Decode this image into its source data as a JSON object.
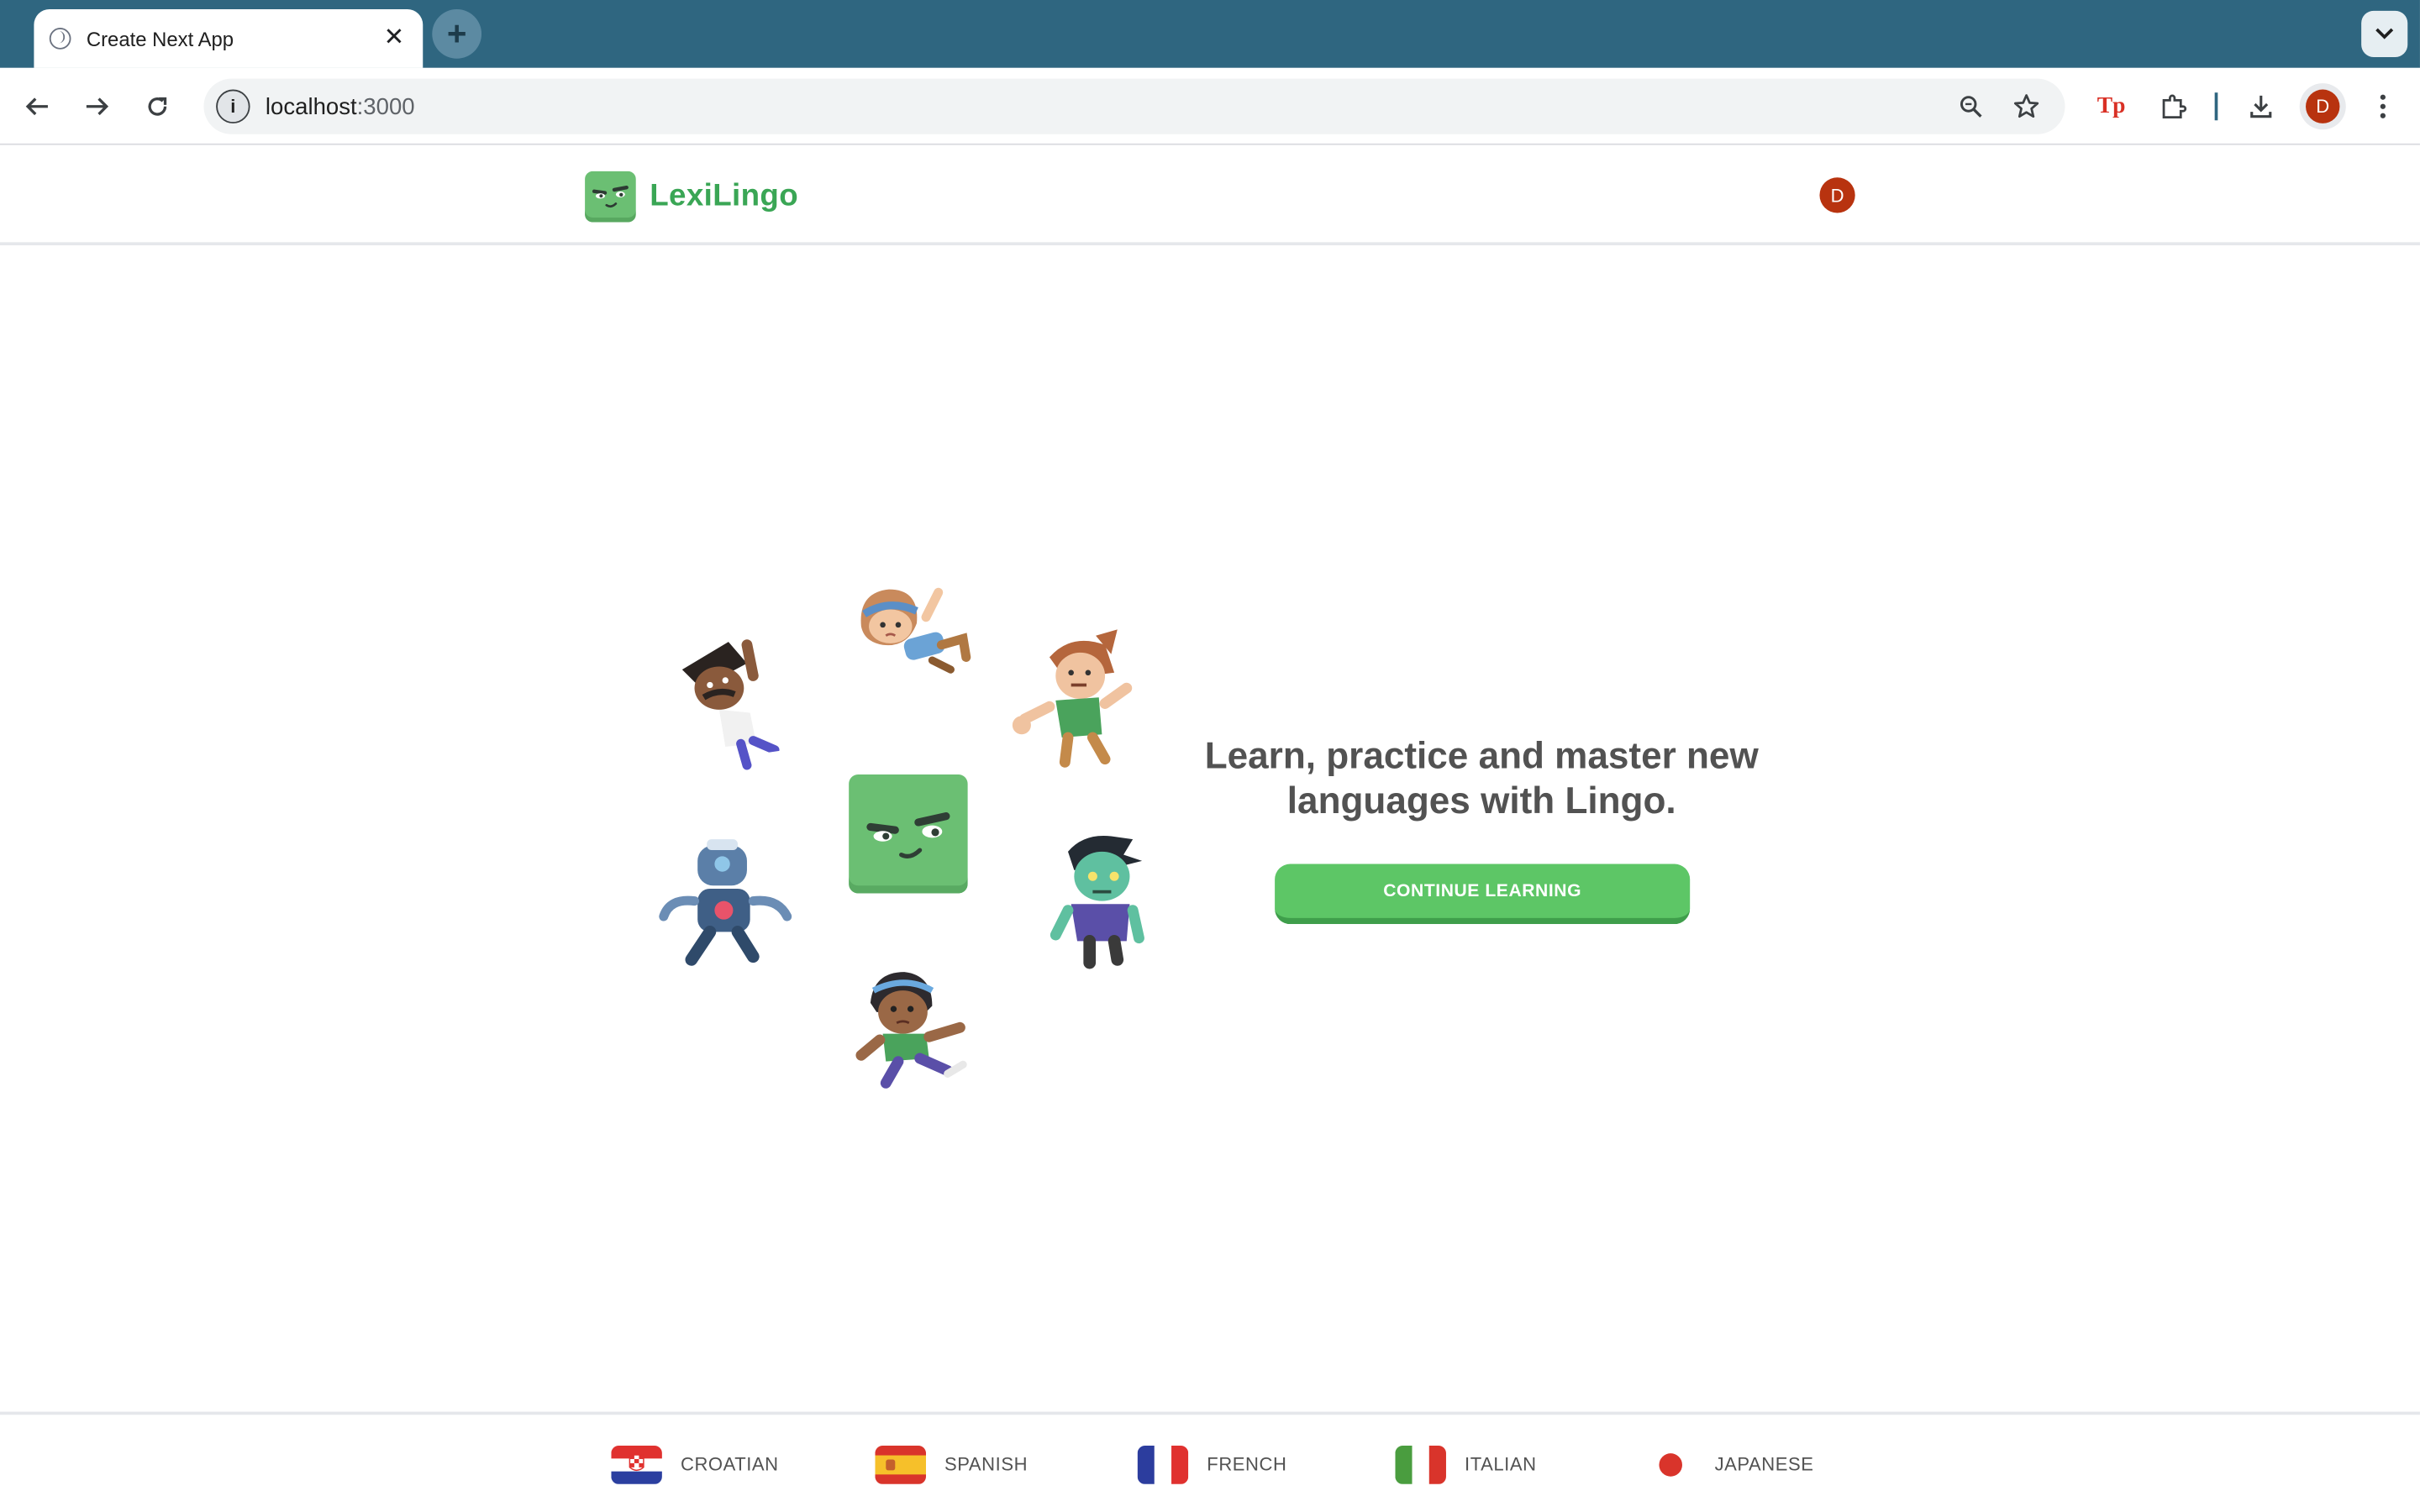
{
  "browser": {
    "tab_title": "Create Next App",
    "tab_close": "✕",
    "new_tab": "+",
    "tab_menu": "⌄",
    "url_host": "localhost",
    "url_port": ":3000",
    "profile_initial": "D"
  },
  "header": {
    "brand": "LexiLingo",
    "avatar_initial": "D"
  },
  "hero": {
    "title": "Learn, practice and master new languages with Lingo.",
    "cta_label": "CONTINUE LEARNING"
  },
  "footer": {
    "languages": [
      {
        "label": "CROATIAN",
        "flag": "croatia-flag-icon"
      },
      {
        "label": "SPANISH",
        "flag": "spain-flag-icon"
      },
      {
        "label": "FRENCH",
        "flag": "france-flag-icon"
      },
      {
        "label": "ITALIAN",
        "flag": "italy-flag-icon"
      },
      {
        "label": "JAPANESE",
        "flag": "japan-flag-icon"
      }
    ]
  },
  "colors": {
    "tabstrip": "#2f6680",
    "brand_green": "#3aa655",
    "button_green": "#5dc666",
    "mascot_green": "#6bbf73",
    "avatar_red": "#b8330f",
    "text_gray": "#525252"
  }
}
